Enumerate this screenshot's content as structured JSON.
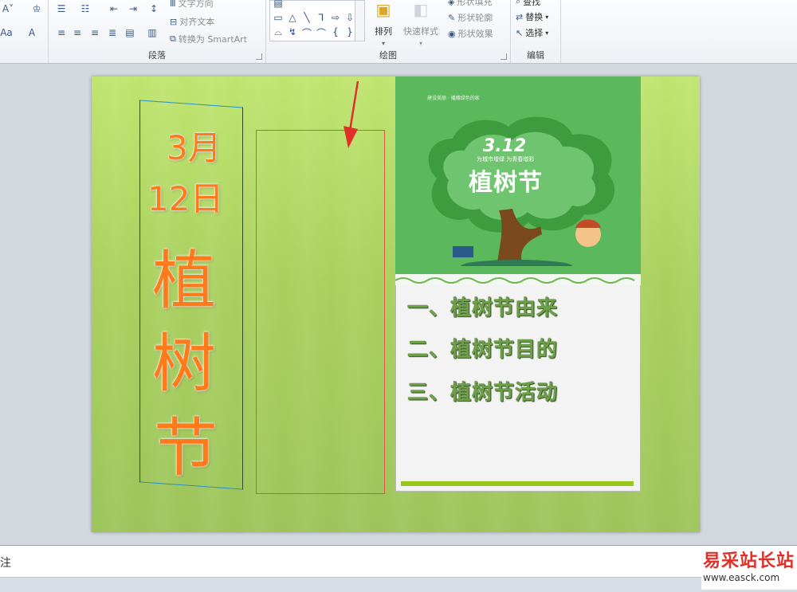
{
  "ribbon": {
    "groups": {
      "paragraph": "段落",
      "drawing": "绘图",
      "editing": "编辑"
    },
    "paragraph": {
      "text_direction": "文字方向",
      "align_text": "对齐文本",
      "convert_smartart": "转换为 SmartArt"
    },
    "drawing": {
      "arrange": "排列",
      "quick_styles": "快速样式",
      "shape_fill": "形状填充",
      "shape_outline": "形状轮廓",
      "shape_effects": "形状效果"
    },
    "editing": {
      "find": "查找",
      "replace": "替换",
      "select": "选择"
    }
  },
  "slide": {
    "vertical_title": {
      "date_month": "3月",
      "date_day": "12日",
      "char1": "植",
      "char2": "树",
      "char3": "节"
    },
    "poster": {
      "tagline": "建设美丽 · 播撒绿色的家",
      "date": "3.12",
      "subtitle": "为城市增绿  为青春增彩",
      "title": "植树节"
    },
    "list_items": [
      "一、植树节由来",
      "二、植树节目的",
      "三、植树节活动"
    ]
  },
  "notes": {
    "placeholder": "注"
  },
  "watermark": {
    "title": "易采站长站",
    "url": "www.easck.com"
  },
  "colors": {
    "slide_bg": "#a9d05e",
    "title_orange": "#ff7a1a",
    "list_green": "#6da046",
    "red_box": "#e0544a"
  }
}
